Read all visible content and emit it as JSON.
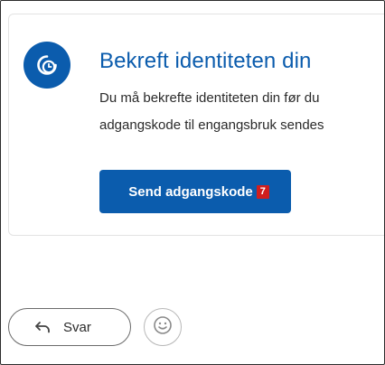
{
  "card": {
    "title": "Bekreft identiteten din",
    "text_line1": "Du må bekrefte identiteten din før du",
    "text_line2": "adgangskode til engangsbruk sendes",
    "send_button_label": "Send adgangskode",
    "send_button_badge": "7",
    "icon": "clock-badge-icon"
  },
  "actions": {
    "reply_label": "Svar",
    "reply_icon": "reply-arrow-icon",
    "emoji_icon": "smiley-icon"
  },
  "colors": {
    "accent": "#0b5cad",
    "badge": "#d01e1e"
  }
}
